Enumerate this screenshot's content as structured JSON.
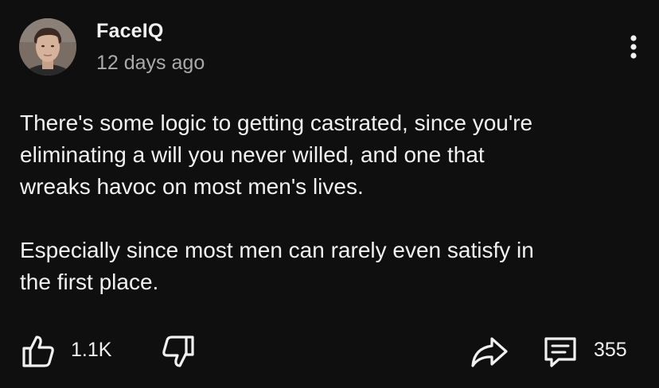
{
  "post": {
    "author": "FaceIQ",
    "timestamp": "12 days ago",
    "paragraphs": [
      "There's some logic to getting castrated, since you're\neliminating a will you never willed, and one that\nwreaks havoc on most men's lives.",
      "Especially since most men can rarely even satisfy in\nthe first place."
    ],
    "likes": "1.1K",
    "comments": "355"
  },
  "icons": {
    "avatar": "profile-photo",
    "more": "vertical-ellipsis-icon",
    "like": "thumbs-up-icon",
    "dislike": "thumbs-down-icon",
    "share": "share-arrow-icon",
    "comment": "comment-bubble-icon"
  },
  "colors": {
    "background": "#0f0f0f",
    "primary_text": "#f1f1f1",
    "secondary_text": "#aaaaaa"
  }
}
